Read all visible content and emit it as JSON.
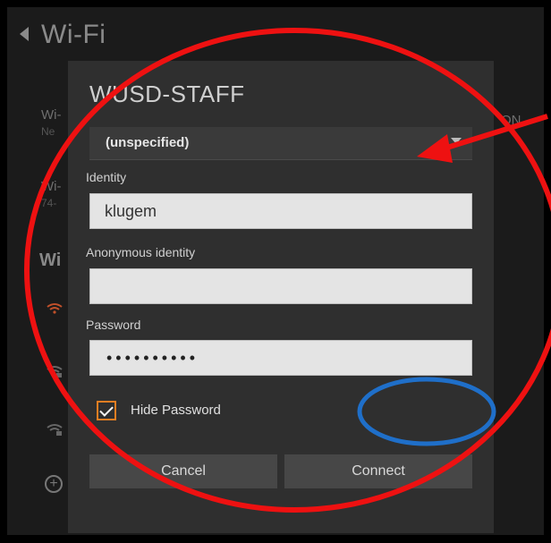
{
  "background": {
    "title": "Wi-Fi",
    "row1_line1": "Wi-",
    "row1_line2": "Ne",
    "row1_right": "ON",
    "row2_line1": "Wi-",
    "row2_line2": "74-",
    "section": "Wi"
  },
  "dialog": {
    "title": "WUSD-STAFF",
    "selected_value": "(unspecified)",
    "identity_label": "Identity",
    "identity_value": "klugem",
    "anon_label": "Anonymous identity",
    "anon_value": "",
    "password_label": "Password",
    "password_mask": "••••••••••",
    "hide_password_label": "Hide Password",
    "cancel_label": "Cancel",
    "connect_label": "Connect"
  },
  "colors": {
    "annotation_red": "#ee1111",
    "annotation_blue": "#1f6fc9",
    "checkbox_accent": "#e67e22"
  }
}
